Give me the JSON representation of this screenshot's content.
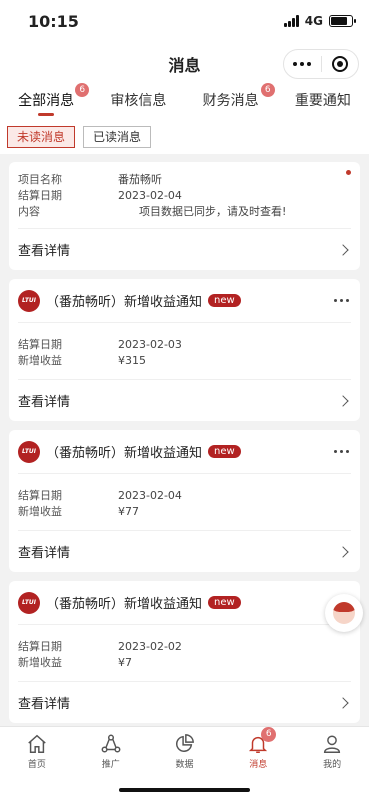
{
  "status_bar": {
    "time": "10:15",
    "network": "4G"
  },
  "nav": {
    "title": "消息"
  },
  "tabs": [
    {
      "label": "全部消息",
      "badge": "6",
      "active": true
    },
    {
      "label": "审核信息"
    },
    {
      "label": "财务消息",
      "badge": "6"
    },
    {
      "label": "重要通知"
    }
  ],
  "filters": {
    "unread": "未读消息",
    "read": "已读消息",
    "active": "unread"
  },
  "first_card": {
    "rows": [
      {
        "key": "项目名称",
        "value": "番茄畅听"
      },
      {
        "key": "结算日期",
        "value": "2023-02-04"
      },
      {
        "key": "内容",
        "value": "项目数据已同步，请及时查看!"
      }
    ],
    "detail_label": "查看详情"
  },
  "cards": [
    {
      "logo_text": "LTUI",
      "title": "（番茄畅听）新增收益通知",
      "tag": "new",
      "rows": [
        {
          "key": "结算日期",
          "value": "2023-02-03"
        },
        {
          "key": "新增收益",
          "value": "¥315"
        }
      ],
      "detail_label": "查看详情"
    },
    {
      "logo_text": "LTUI",
      "title": "（番茄畅听）新增收益通知",
      "tag": "new",
      "rows": [
        {
          "key": "结算日期",
          "value": "2023-02-04"
        },
        {
          "key": "新增收益",
          "value": "¥77"
        }
      ],
      "detail_label": "查看详情"
    },
    {
      "logo_text": "LTUI",
      "title": "（番茄畅听）新增收益通知",
      "tag": "new",
      "rows": [
        {
          "key": "结算日期",
          "value": "2023-02-02"
        },
        {
          "key": "新增收益",
          "value": "¥7"
        }
      ],
      "detail_label": "查看详情"
    }
  ],
  "bottom_nav": [
    {
      "label": "首页",
      "icon": "home-icon"
    },
    {
      "label": "推广",
      "icon": "share-icon"
    },
    {
      "label": "数据",
      "icon": "pie-chart-icon"
    },
    {
      "label": "消息",
      "icon": "bell-icon",
      "badge": "6",
      "active": true
    },
    {
      "label": "我的",
      "icon": "user-icon"
    }
  ],
  "colors": {
    "accent": "#c0392b",
    "badge": "#e07070",
    "brand": "#b22222"
  }
}
